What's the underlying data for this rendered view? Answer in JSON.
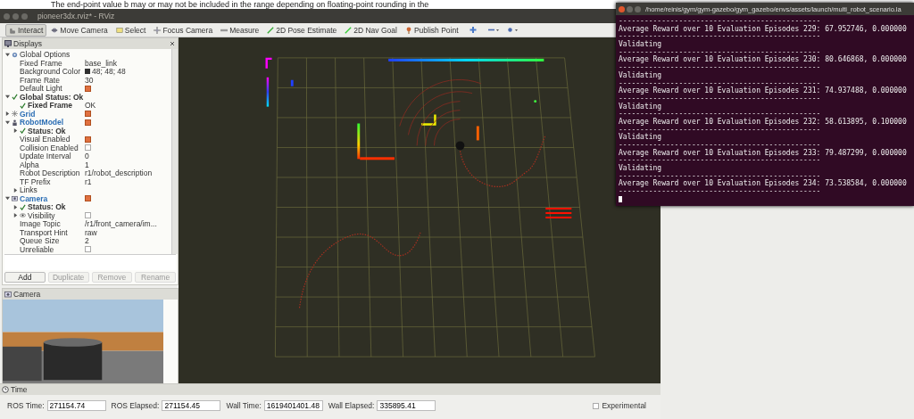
{
  "background_page": {
    "text": "The end-point value b may or may not be included in the range depending on floating-point rounding in the"
  },
  "window": {
    "title": "pioneer3dx.rviz* - RViz"
  },
  "toolbar": {
    "tools": [
      {
        "label": "Interact",
        "kind": "interact",
        "selected": true
      },
      {
        "label": "Move Camera",
        "kind": "move",
        "selected": false
      },
      {
        "label": "Select",
        "kind": "select",
        "selected": false
      },
      {
        "label": "Focus Camera",
        "kind": "focus",
        "selected": false
      },
      {
        "label": "Measure",
        "kind": "measure",
        "selected": false
      },
      {
        "label": "2D Pose Estimate",
        "kind": "pose",
        "selected": false
      },
      {
        "label": "2D Nav Goal",
        "kind": "goal",
        "selected": false
      },
      {
        "label": "Publish Point",
        "kind": "point",
        "selected": false
      }
    ]
  },
  "displays": {
    "title": "Displays",
    "items": [
      {
        "label": "Global Options",
        "kind": "global",
        "expanded": true,
        "children": [
          {
            "label": "Fixed Frame",
            "kind": "property",
            "value": "base_link"
          },
          {
            "label": "Background Color",
            "kind": "property",
            "value": "48; 48; 48",
            "color": "#303030"
          },
          {
            "label": "Frame Rate",
            "kind": "property",
            "value": "30"
          },
          {
            "label": "Default Light",
            "kind": "property",
            "checked": true
          }
        ]
      },
      {
        "label": "Global Status: Ok",
        "kind": "status",
        "expanded": true,
        "children": [
          {
            "label": "Fixed Frame",
            "kind": "status",
            "value": "OK"
          }
        ]
      },
      {
        "label": "Grid",
        "kind": "grid",
        "expanded": false,
        "checked": true
      },
      {
        "label": "RobotModel",
        "kind": "robot",
        "expanded": true,
        "checked": true,
        "children": [
          {
            "label": "Status: Ok",
            "kind": "status",
            "expanded": false
          },
          {
            "label": "Visual Enabled",
            "kind": "property",
            "checked": true
          },
          {
            "label": "Collision Enabled",
            "kind": "property",
            "checked": false
          },
          {
            "label": "Update Interval",
            "kind": "property",
            "value": "0"
          },
          {
            "label": "Alpha",
            "kind": "property",
            "value": "1"
          },
          {
            "label": "Robot Description",
            "kind": "property",
            "value": "r1/robot_description"
          },
          {
            "label": "TF Prefix",
            "kind": "property",
            "value": "r1"
          },
          {
            "label": "Links",
            "kind": "property",
            "expanded": false
          }
        ]
      },
      {
        "label": "Camera",
        "kind": "camera",
        "expanded": true,
        "checked": true,
        "children": [
          {
            "label": "Status: Ok",
            "kind": "status",
            "expanded": false
          },
          {
            "label": "Visibility",
            "kind": "visibility",
            "expanded": false,
            "checked": false
          },
          {
            "label": "Image Topic",
            "kind": "property",
            "value": "/r1/front_camera/im..."
          },
          {
            "label": "Transport Hint",
            "kind": "property",
            "value": "raw"
          },
          {
            "label": "Queue Size",
            "kind": "property",
            "value": "2"
          },
          {
            "label": "Unreliable",
            "kind": "property",
            "checked": false
          }
        ]
      }
    ],
    "buttons": [
      {
        "label": "Add",
        "disabled": false
      },
      {
        "label": "Duplicate",
        "disabled": true
      },
      {
        "label": "Remove",
        "disabled": true
      },
      {
        "label": "Rename",
        "disabled": true
      }
    ]
  },
  "camera_panel": {
    "title": "Camera"
  },
  "time_panel": {
    "title": "Time",
    "fields": [
      {
        "label": "ROS Time:",
        "value": "271154.74"
      },
      {
        "label": "ROS Elapsed:",
        "value": "271154.45"
      },
      {
        "label": "Wall Time:",
        "value": "1619401401.48"
      },
      {
        "label": "Wall Elapsed:",
        "value": "335895.41"
      }
    ],
    "experimental": {
      "label": "Experimental",
      "checked": false
    }
  },
  "terminal": {
    "title": "/home/reinis/gym/gym-gazebo/gym_gazebo/envs/assets/launch/multi_robot_scenario.la",
    "lines": [
      "-----------------------------------------------",
      "Average Reward over 10 Evaluation Episodes 229: 67.952746, 0.000000",
      "-----------------------------------------------",
      "Validating",
      "-----------------------------------------------",
      "Average Reward over 10 Evaluation Episodes 230: 80.646868, 0.000000",
      "-----------------------------------------------",
      "Validating",
      "-----------------------------------------------",
      "Average Reward over 10 Evaluation Episodes 231: 74.937488, 0.000000",
      "-----------------------------------------------",
      "Validating",
      "-----------------------------------------------",
      "Average Reward over 10 Evaluation Episodes 232: 58.613895, 0.100000",
      "-----------------------------------------------",
      "Validating",
      "-----------------------------------------------",
      "Average Reward over 10 Evaluation Episodes 233: 79.487299, 0.000000",
      "-----------------------------------------------",
      "Validating",
      "-----------------------------------------------",
      "Average Reward over 10 Evaluation Episodes 234: 73.538584, 0.000000",
      "-----------------------------------------------"
    ]
  }
}
